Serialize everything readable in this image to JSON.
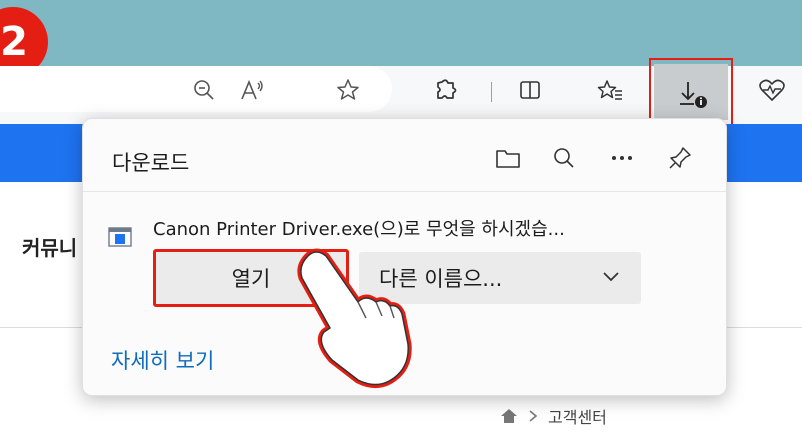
{
  "step_badge": "2",
  "toolbar": {
    "icons": [
      "zoom-out-icon",
      "read-aloud-icon",
      "favorite-star-icon",
      "extensions-icon",
      "split-screen-icon",
      "favorites-icon",
      "downloads-icon",
      "browser-essentials-icon"
    ]
  },
  "page": {
    "left_text": "커뮤니",
    "breadcrumb_text": "고객센터"
  },
  "downloads": {
    "title": "다운로드",
    "file_name": "Canon Printer Driver.exe(으)로 무엇을 하시겠습...",
    "open_label": "열기",
    "save_as_label": "다른 이름으...",
    "more_label": "자세히 보기"
  },
  "colors": {
    "titlebar": "#7fb7c3",
    "highlight": "#e41e12",
    "blue_banner": "#1e73f0",
    "link": "#0f6cbd"
  }
}
